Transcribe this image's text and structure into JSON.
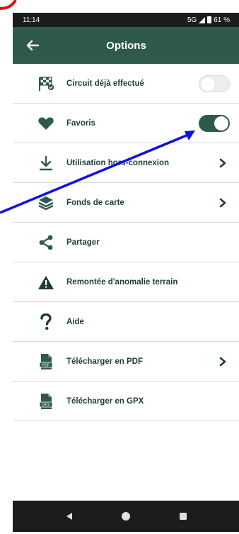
{
  "status_bar": {
    "time": "11:14",
    "network": "5G",
    "battery": "61 %"
  },
  "app_bar": {
    "title": "Options"
  },
  "menu": [
    {
      "label": "Circuit déjà effectué",
      "icon": "checkered-flag-icon",
      "control": "toggle",
      "toggle_on": false
    },
    {
      "label": "Favoris",
      "icon": "heart-icon",
      "control": "toggle",
      "toggle_on": true
    },
    {
      "label": "Utilisation hors-connexion",
      "icon": "download-icon",
      "control": "chevron"
    },
    {
      "label": "Fonds de carte",
      "icon": "layers-icon",
      "control": "chevron"
    },
    {
      "label": "Partager",
      "icon": "share-icon",
      "control": "none"
    },
    {
      "label": "Remontée d'anomalie terrain",
      "icon": "warning-icon",
      "control": "none"
    },
    {
      "label": "Aide",
      "icon": "question-icon",
      "control": "none"
    },
    {
      "label": "Télécharger en PDF",
      "icon": "pdf-file-icon",
      "control": "chevron",
      "badge": "PDF"
    },
    {
      "label": "Télécharger en GPX",
      "icon": "gpx-file-icon",
      "control": "none",
      "badge": "GPX"
    }
  ],
  "colors": {
    "primary": "#2f5a4b",
    "annotation_arrow": "#1010e0",
    "annotation_mark": "#e01010"
  }
}
